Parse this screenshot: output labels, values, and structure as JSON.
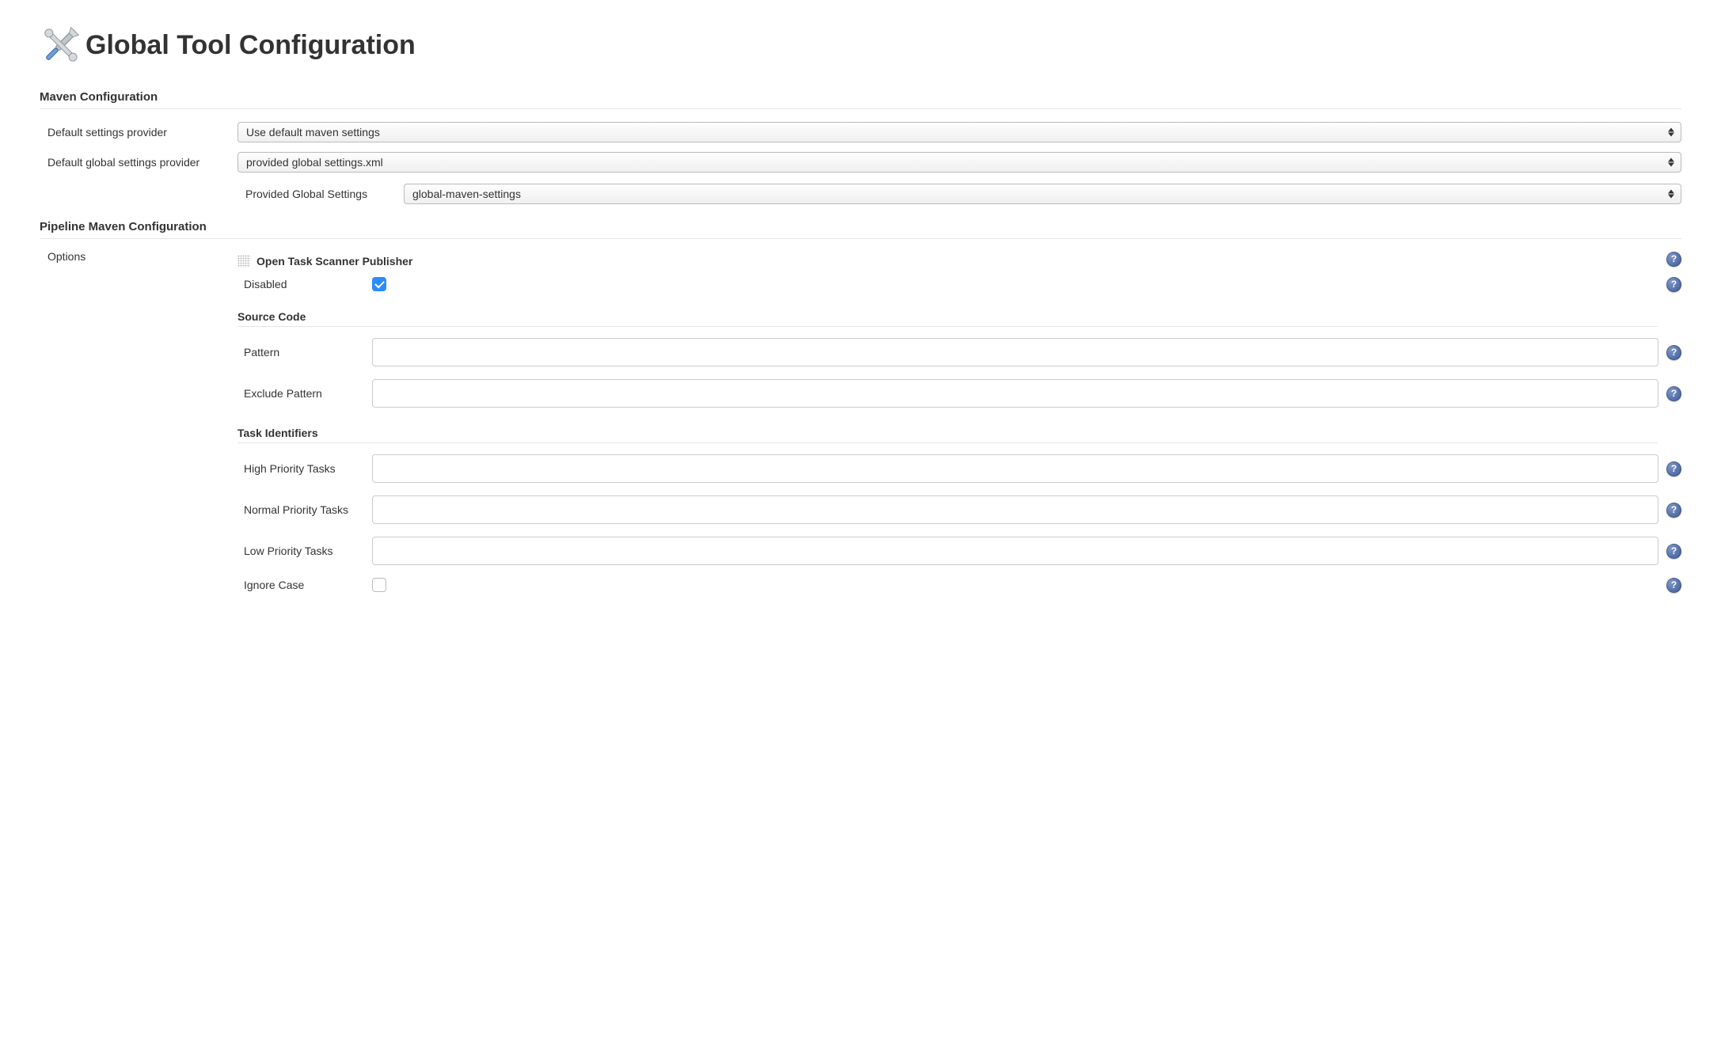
{
  "page": {
    "title": "Global Tool Configuration"
  },
  "maven": {
    "heading": "Maven Configuration",
    "default_settings": {
      "label": "Default settings provider",
      "value": "Use default maven settings"
    },
    "global_settings": {
      "label": "Default global settings provider",
      "value": "provided global settings.xml"
    },
    "provided_global": {
      "label": "Provided Global Settings",
      "value": "global-maven-settings"
    }
  },
  "pipeline": {
    "heading": "Pipeline Maven Configuration",
    "options_label": "Options",
    "publisher": {
      "title": "Open Task Scanner Publisher",
      "disabled_label": "Disabled",
      "disabled_checked": true
    },
    "source_code": {
      "heading": "Source Code",
      "pattern_label": "Pattern",
      "pattern_value": "",
      "exclude_label": "Exclude Pattern",
      "exclude_value": ""
    },
    "task_identifiers": {
      "heading": "Task Identifiers",
      "high_label": "High Priority Tasks",
      "high_value": "",
      "normal_label": "Normal Priority Tasks",
      "normal_value": "",
      "low_label": "Low Priority Tasks",
      "low_value": "",
      "ignore_case_label": "Ignore Case",
      "ignore_case_checked": false
    }
  }
}
